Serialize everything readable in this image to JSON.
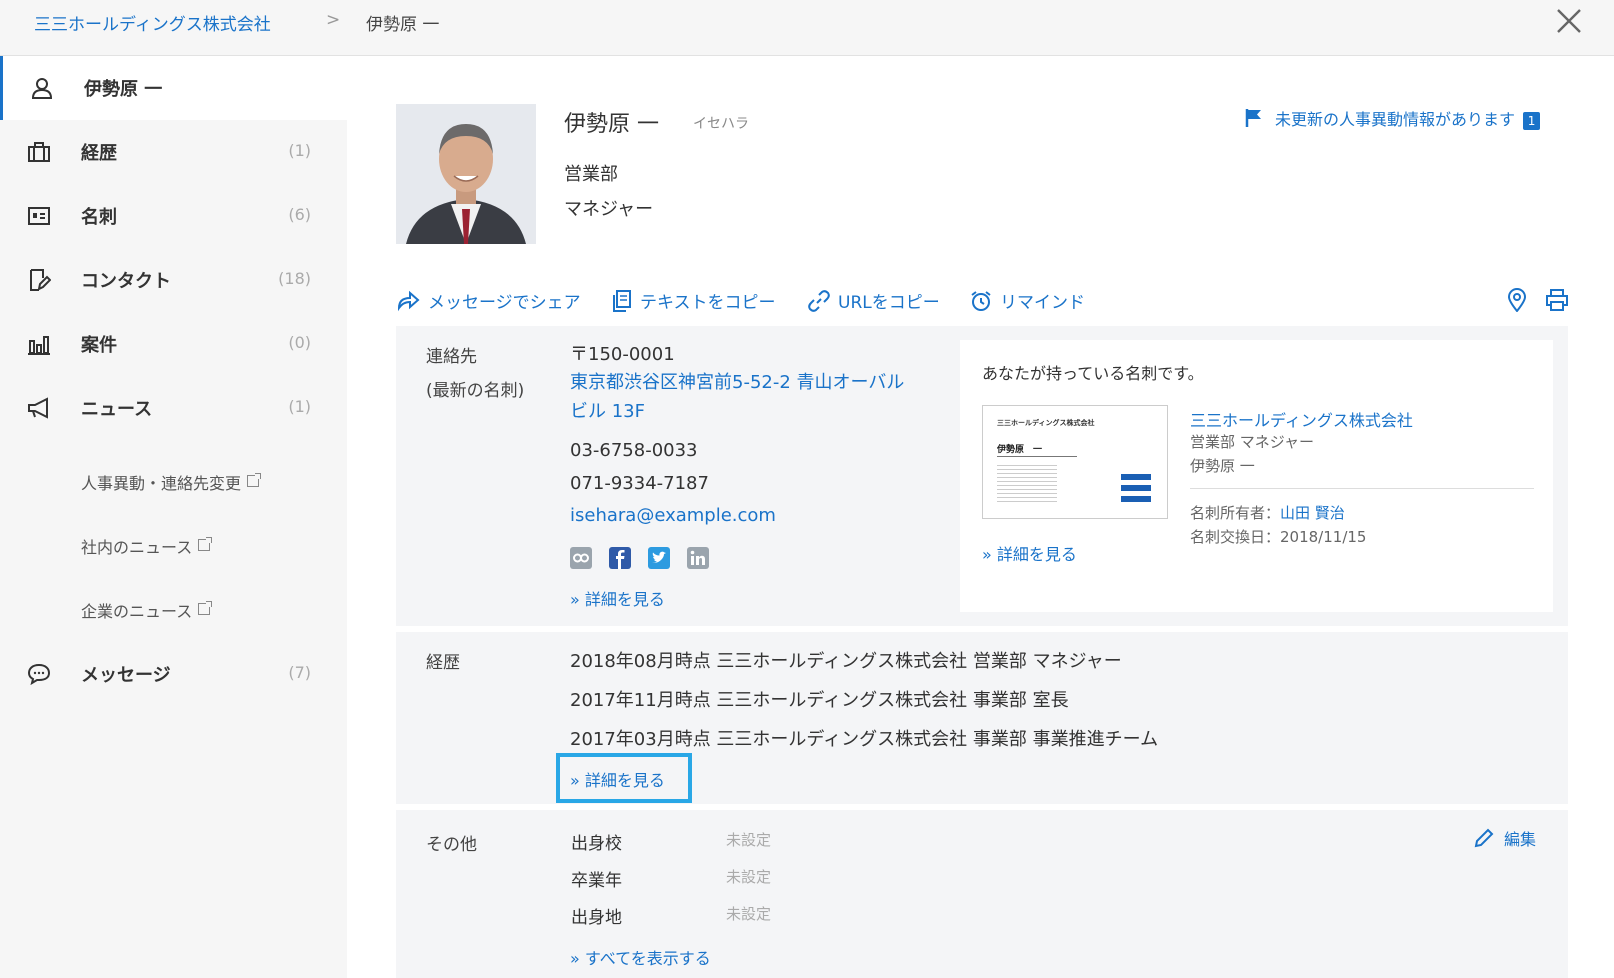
{
  "breadcrumb": {
    "company": "三三ホールディングス株式会社",
    "separator": ">",
    "person": "伊勢原 一"
  },
  "sidebar": {
    "items": [
      {
        "label": "伊勢原 一",
        "count": ""
      },
      {
        "label": "経歴",
        "count": "(1)"
      },
      {
        "label": "名刺",
        "count": "(6)"
      },
      {
        "label": "コンタクト",
        "count": "(18)"
      },
      {
        "label": "案件",
        "count": "(0)"
      },
      {
        "label": "ニュース",
        "count": "(1)"
      },
      {
        "label": "メッセージ",
        "count": "(7)"
      }
    ],
    "news_sub": [
      "人事異動・連絡先変更",
      "社内のニュース",
      "企業のニュース"
    ]
  },
  "profile": {
    "name": "伊勢原 一",
    "kana": "イセハラ",
    "department": "営業部",
    "title": "マネジャー"
  },
  "notice": {
    "text": "未更新の人事異動情報があります",
    "count": "1"
  },
  "actions": {
    "share": "メッセージでシェア",
    "copy_text": "テキストをコピー",
    "copy_url": "URLをコピー",
    "remind": "リマインド"
  },
  "contact": {
    "label_line1": "連絡先",
    "label_line2": "(最新の名刺)",
    "postal": "〒150-0001",
    "address_line1": "東京都渋谷区神宮前5-52-2 青山オーバル",
    "address_line2": "ビル 13F",
    "phone1": "03-6758-0033",
    "phone2": "071-9334-7187",
    "email": "isehara@example.com",
    "details_link": "» 詳細を見る"
  },
  "card": {
    "heading": "あなたが持っている名刺です。",
    "company": "三三ホールディングス株式会社",
    "dept_title": "営業部 マネジャー",
    "name": "伊勢原 一",
    "owner_label": "名刺所有者：",
    "owner": "山田 賢治",
    "exchange_date": "名刺交換日：2018/11/15",
    "details_link": "» 詳細を見る",
    "thumb_company": "三三ホールディングス株式会社",
    "thumb_name": "伊勢原　一"
  },
  "career": {
    "label": "経歴",
    "entries": [
      "2018年08月時点 三三ホールディングス株式会社 営業部 マネジャー",
      "2017年11月時点 三三ホールディングス株式会社 事業部 室長",
      "2017年03月時点 三三ホールディングス株式会社 事業部 事業推進チーム"
    ],
    "details_link": "» 詳細を見る"
  },
  "other": {
    "label": "その他",
    "edit": "編集",
    "fields": [
      {
        "name": "出身校",
        "value": "未設定"
      },
      {
        "name": "卒業年",
        "value": "未設定"
      },
      {
        "name": "出身地",
        "value": "未設定"
      }
    ],
    "show_all": "» すべてを表示する"
  },
  "colors": {
    "accent": "#1a73c9",
    "highlight": "#29a7e6",
    "sidebar_bg": "#f6f6f6",
    "panel_bg": "#f4f5f7"
  }
}
